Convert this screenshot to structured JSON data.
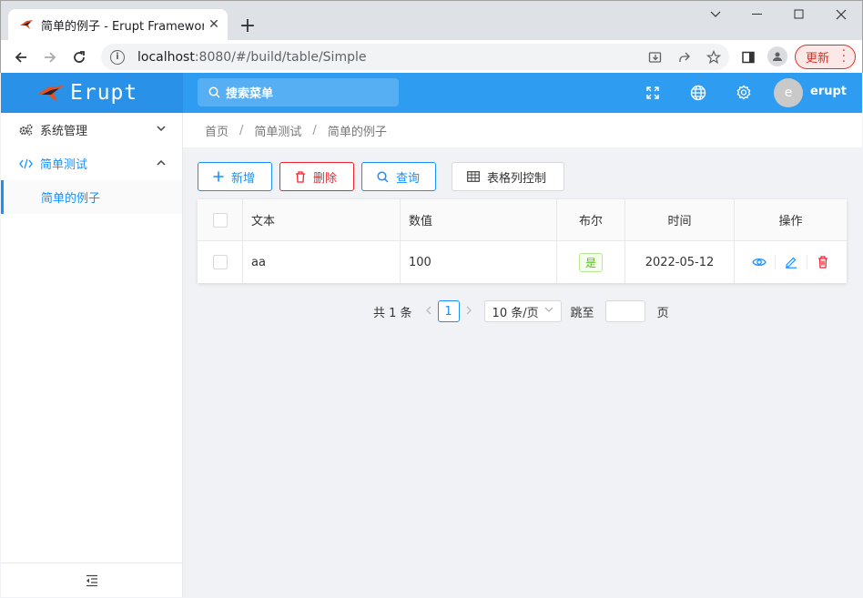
{
  "browser": {
    "tab_title": "简单的例子 - Erupt Framework",
    "url_host": "localhost",
    "url_path": ":8080/#/build/table/Simple",
    "update_label": "更新"
  },
  "header": {
    "logo_text": "Erupt",
    "search_placeholder": "搜索菜单",
    "avatar_letter": "e",
    "username": "erupt"
  },
  "sidebar": {
    "items": [
      {
        "label": "系统管理"
      },
      {
        "label": "简单测试"
      }
    ],
    "sub_item": "简单的例子"
  },
  "breadcrumb": [
    "首页",
    "简单测试",
    "简单的例子"
  ],
  "actions": {
    "add": "新增",
    "delete": "删除",
    "query": "查询",
    "columns": "表格列控制"
  },
  "table": {
    "columns": [
      "文本",
      "数值",
      "布尔",
      "时间",
      "操作"
    ],
    "rows": [
      {
        "text": "aa",
        "number": "100",
        "bool": "是",
        "time": "2022-05-12"
      }
    ]
  },
  "pagination": {
    "total": "共 1 条",
    "current": "1",
    "page_size": "10 条/页",
    "jump_label": "跳至",
    "page_suffix": "页"
  },
  "colors": {
    "primary": "#1890ff",
    "danger": "#f5222d",
    "success": "#52c41a",
    "header": "#2d9cf1"
  }
}
